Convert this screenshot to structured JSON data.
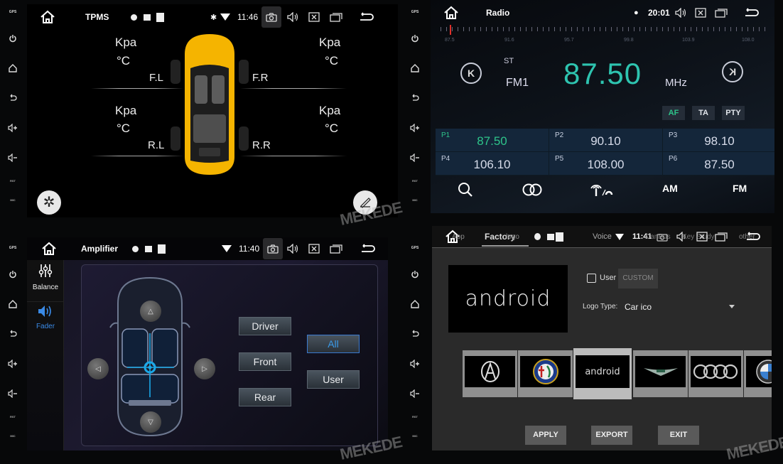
{
  "side_panel": {
    "gps_label": "GPS",
    "rst_label": "RST",
    "mic_label": "MIC"
  },
  "tpms": {
    "title": "TPMS",
    "time": "11:46",
    "tires": [
      {
        "position": "F.L",
        "pressure_unit": "Kpa",
        "temp_unit": "°C"
      },
      {
        "position": "F.R",
        "pressure_unit": "Kpa",
        "temp_unit": "°C"
      },
      {
        "position": "R.L",
        "pressure_unit": "Kpa",
        "temp_unit": "°C"
      },
      {
        "position": "R.R",
        "pressure_unit": "Kpa",
        "temp_unit": "°C"
      }
    ],
    "car_color": "#f5b400"
  },
  "radio": {
    "title": "Radio",
    "time": "20:01",
    "scale_labels": [
      "87.5",
      "91.6",
      "95.7",
      "99.8",
      "103.9",
      "108.0"
    ],
    "stereo": "ST",
    "band": "FM1",
    "frequency": "87.50",
    "unit": "MHz",
    "accent_color": "#2ec4b0",
    "toggles": [
      {
        "label": "AF",
        "active": true
      },
      {
        "label": "TA",
        "active": false
      },
      {
        "label": "PTY",
        "active": false
      }
    ],
    "presets": [
      {
        "name": "P1",
        "freq": "87.50",
        "active": true
      },
      {
        "name": "P2",
        "freq": "90.10",
        "active": false
      },
      {
        "name": "P3",
        "freq": "98.10",
        "active": false
      },
      {
        "name": "P4",
        "freq": "106.10",
        "active": false
      },
      {
        "name": "P5",
        "freq": "108.00",
        "active": false
      },
      {
        "name": "P6",
        "freq": "87.50",
        "active": false
      }
    ],
    "bottom": {
      "am": "AM",
      "fm": "FM"
    }
  },
  "amplifier": {
    "title": "Amplifier",
    "time": "11:40",
    "tabs": [
      {
        "label": "Balance",
        "active": false
      },
      {
        "label": "Fader",
        "active": true
      }
    ],
    "presets_left": [
      "Driver",
      "Front",
      "Rear"
    ],
    "presets_right": [
      {
        "label": "All",
        "active": true
      },
      {
        "label": "User",
        "active": false
      }
    ]
  },
  "factory": {
    "title": "Factory",
    "time": "11:41",
    "overlay_text": {
      "left": "App",
      "logo": "logo",
      "voice": "Voice",
      "canbus": "CanBus",
      "key": "Key Study",
      "other": "other"
    },
    "preview_text": "android",
    "user_label": "User",
    "user_checked": false,
    "custom_label": "CUSTOM",
    "logo_type_label": "Logo Type:",
    "logo_type_value": "Car ico",
    "logos": [
      "Acura",
      "Alfa Romeo",
      "android",
      "Aston Martin",
      "Audi",
      "BMW"
    ],
    "selected_logo": "android",
    "buttons": {
      "apply": "APPLY",
      "export": "EXPORT",
      "exit": "EXIT"
    }
  },
  "watermark": "MEKEDE"
}
